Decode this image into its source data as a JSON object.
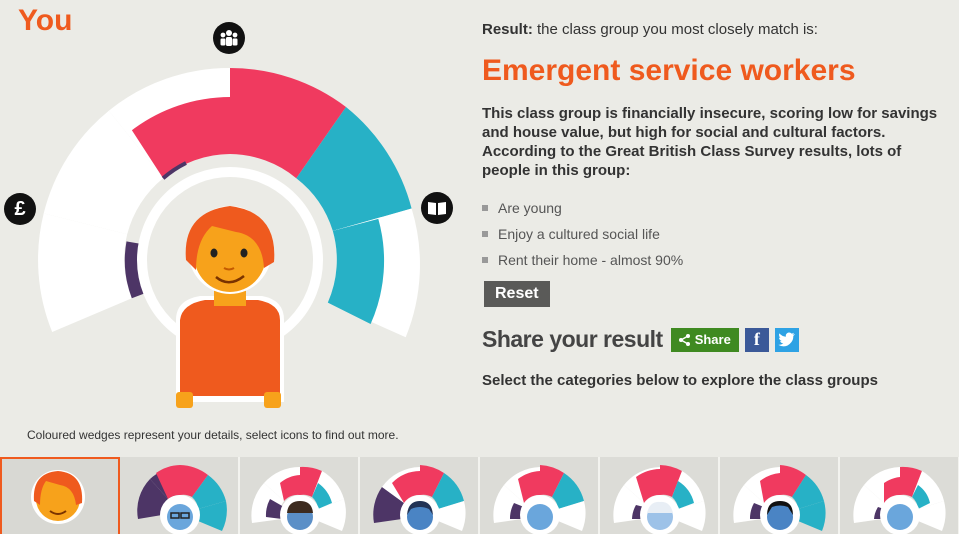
{
  "heading": "You",
  "caption": "Coloured wedges represent your details, select icons to find out more.",
  "icons": {
    "social": "people-group-icon",
    "economic": "pound-sign-icon",
    "economic_glyph": "£",
    "cultural": "open-book-icon"
  },
  "colors": {
    "orange": "#ef5a1e",
    "pink": "#f03a5f",
    "teal": "#27b1c6",
    "purple": "#4d3566",
    "white": "#ffffff"
  },
  "result": {
    "prefix": "Result:",
    "text": " the class group you most closely match is:",
    "class_name": "Emergent service workers",
    "description": "This class group is financially insecure, scoring low for savings and house value, but high for social and cultural factors. According to the Great British Class Survey results, lots of people in this group:",
    "traits": [
      "Are young",
      "Enjoy a cultured social life",
      "Rent their home - almost 90%"
    ]
  },
  "reset_label": "Reset",
  "share": {
    "title": "Share your result",
    "button_label": "Share",
    "facebook_glyph": "f",
    "twitter_glyph": "t"
  },
  "select_text": "Select the categories below to explore the class groups",
  "thumbnails": [
    {
      "name": "you-thumb",
      "selected": true
    },
    {
      "name": "class-group-1-thumb",
      "selected": false
    },
    {
      "name": "class-group-2-thumb",
      "selected": false
    },
    {
      "name": "class-group-3-thumb",
      "selected": false
    },
    {
      "name": "class-group-4-thumb",
      "selected": false
    },
    {
      "name": "class-group-5-thumb",
      "selected": false
    },
    {
      "name": "class-group-6-thumb",
      "selected": false
    },
    {
      "name": "class-group-7-thumb",
      "selected": false
    }
  ]
}
